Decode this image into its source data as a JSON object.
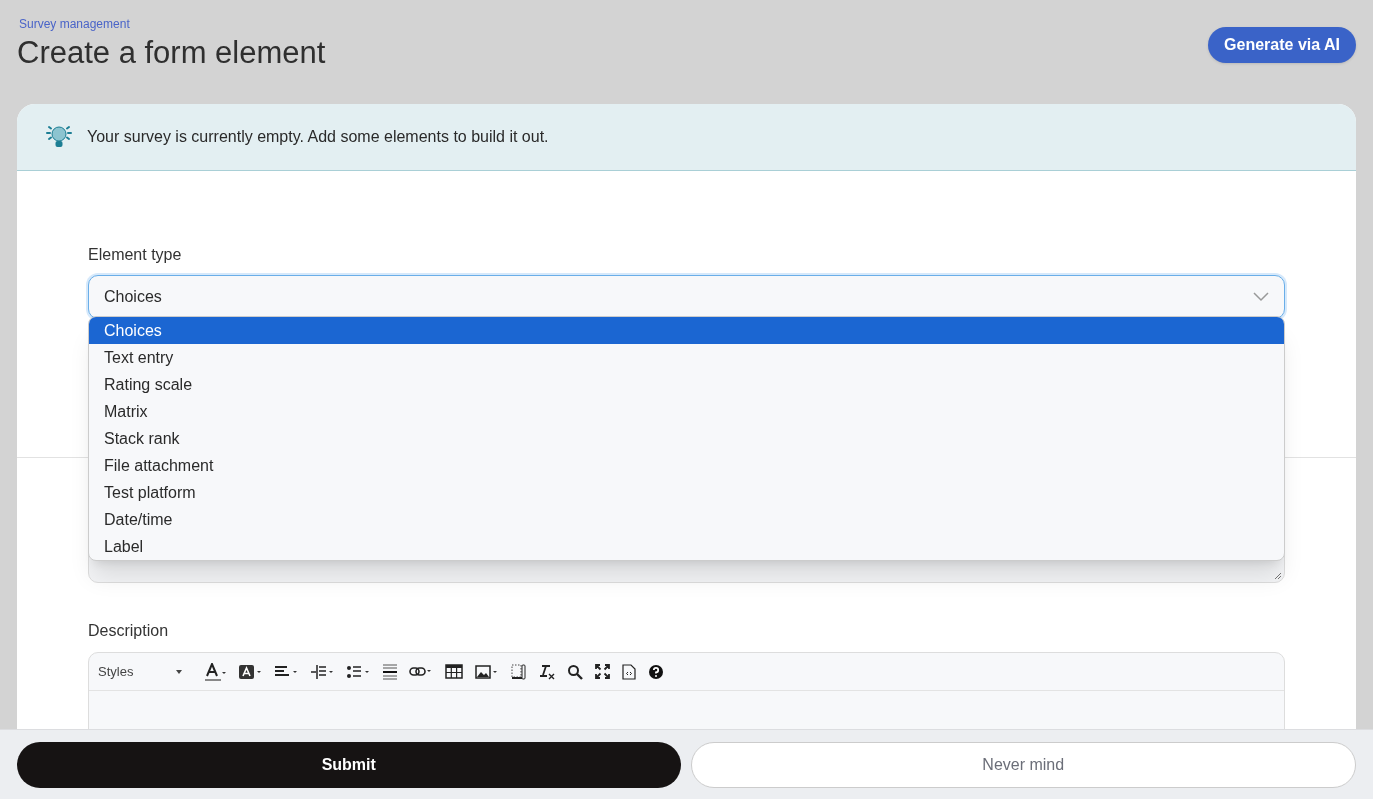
{
  "breadcrumb": "Survey management",
  "title": "Create a form element",
  "generate_button": "Generate via AI",
  "notice": "Your survey is currently empty. Add some elements to build it out.",
  "element_type": {
    "label": "Element type",
    "value": "Choices",
    "expanded": true,
    "options": [
      {
        "label": "Choices",
        "selected": true
      },
      {
        "label": "Text entry",
        "selected": false
      },
      {
        "label": "Rating scale",
        "selected": false
      },
      {
        "label": "Matrix",
        "selected": false
      },
      {
        "label": "Stack rank",
        "selected": false
      },
      {
        "label": "File attachment",
        "selected": false
      },
      {
        "label": "Test platform",
        "selected": false
      },
      {
        "label": "Date/time",
        "selected": false
      },
      {
        "label": "Label",
        "selected": false
      }
    ]
  },
  "description": {
    "label": "Description",
    "styles_dropdown": "Styles"
  },
  "buttons": {
    "submit": "Submit",
    "cancel": "Never mind"
  }
}
